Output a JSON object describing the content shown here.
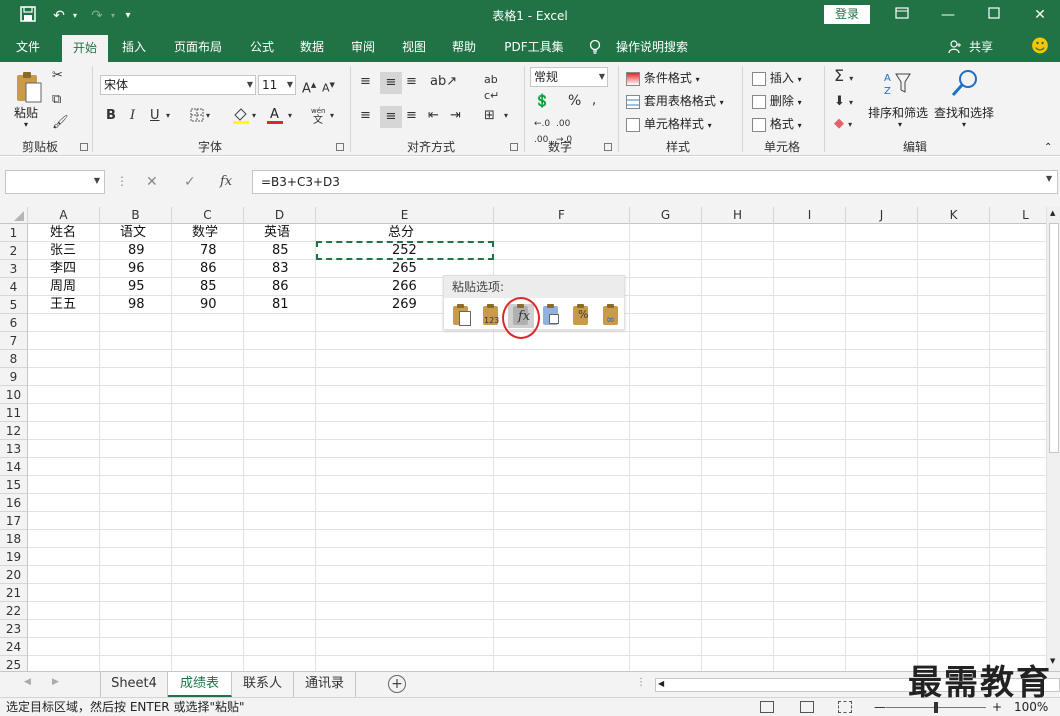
{
  "window": {
    "title": "表格1  -  Excel",
    "login_label": "登录"
  },
  "ribbon_tabs": [
    "文件",
    "开始",
    "插入",
    "页面布局",
    "公式",
    "数据",
    "审阅",
    "视图",
    "帮助",
    "PDF工具集",
    "操作说明搜索"
  ],
  "share_label": "共享",
  "groups": {
    "clipboard": {
      "label": "剪贴板",
      "paste": "粘贴"
    },
    "font": {
      "label": "字体",
      "font_name": "宋体",
      "font_size": "11",
      "bold": "B",
      "italic": "I",
      "underline": "U"
    },
    "alignment": {
      "label": "对齐方式"
    },
    "number": {
      "label": "数字",
      "format": "常规"
    },
    "styles": {
      "label": "样式",
      "conditional": "条件格式",
      "table": "套用表格格式",
      "cell_styles": "单元格样式"
    },
    "cells": {
      "label": "单元格",
      "insert": "插入",
      "delete": "删除",
      "format": "格式"
    },
    "editing": {
      "label": "编辑",
      "sort": "排序和筛选",
      "find": "查找和选择"
    }
  },
  "formula_bar": {
    "name_box": "",
    "formula": "=B3+C3+D3"
  },
  "columns": [
    "A",
    "B",
    "C",
    "D",
    "E",
    "F",
    "G",
    "H",
    "I",
    "J",
    "K",
    "L"
  ],
  "rows": [
    "1",
    "2",
    "3",
    "4",
    "5",
    "6",
    "7",
    "8",
    "9",
    "10",
    "11",
    "12",
    "13",
    "14",
    "15",
    "16",
    "17",
    "18",
    "19",
    "20",
    "21",
    "22",
    "23",
    "24",
    "25"
  ],
  "table": {
    "headers": [
      "姓名",
      "语文",
      "数学",
      "英语",
      "总分"
    ],
    "data": [
      [
        "张三",
        "89",
        "78",
        "85",
        "252"
      ],
      [
        "李四",
        "96",
        "86",
        "83",
        "265"
      ],
      [
        "周周",
        "95",
        "85",
        "86",
        "266"
      ],
      [
        "王五",
        "98",
        "90",
        "81",
        "269"
      ]
    ]
  },
  "paste_options": {
    "title": "粘贴选项:",
    "buttons": [
      "paste",
      "values",
      "formulas",
      "transpose",
      "formatting",
      "paste-link"
    ],
    "values_label": "123",
    "formulas_label": "fx"
  },
  "sheets": [
    "Sheet4",
    "成绩表",
    "联系人",
    "通讯录"
  ],
  "active_sheet": "成绩表",
  "status": {
    "message": "选定目标区域，然后按 ENTER 或选择\"粘贴\"",
    "zoom": "100%"
  },
  "watermark": "最需教育",
  "colors": {
    "accent": "#217346",
    "highlight": "#e0262b"
  }
}
